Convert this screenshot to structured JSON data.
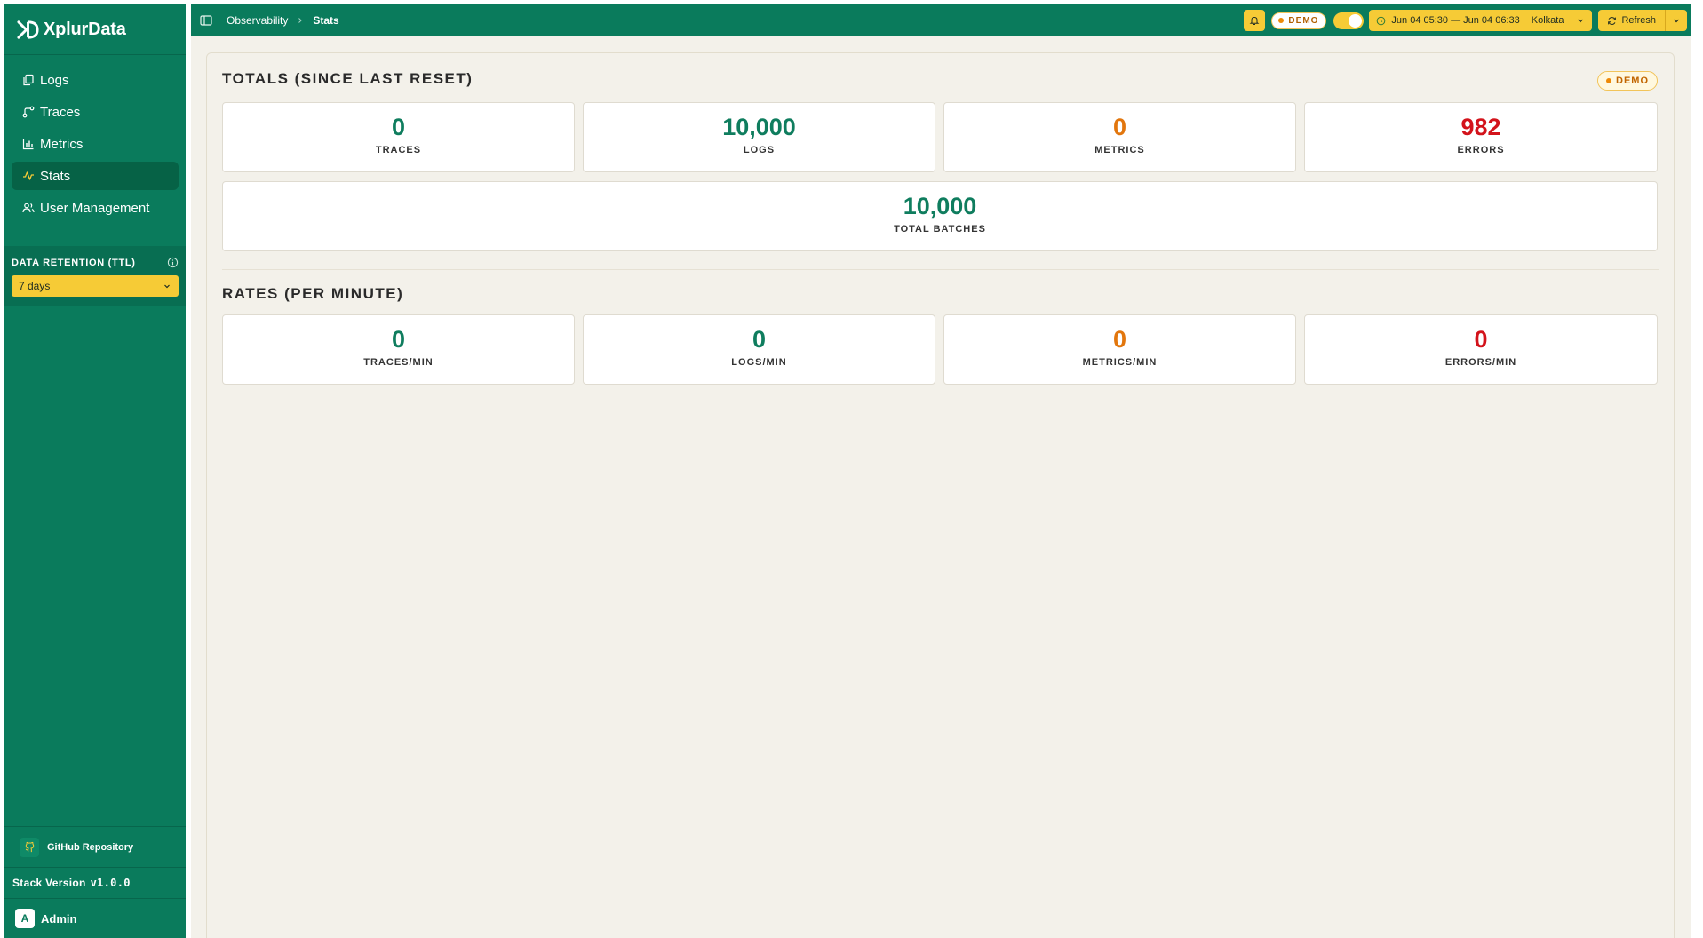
{
  "brand": {
    "name": "XplurData"
  },
  "sidebar": {
    "items": [
      {
        "label": "Logs",
        "icon": "logs-icon"
      },
      {
        "label": "Traces",
        "icon": "traces-icon"
      },
      {
        "label": "Metrics",
        "icon": "metrics-icon"
      },
      {
        "label": "Stats",
        "icon": "stats-icon",
        "active": true
      },
      {
        "label": "User Management",
        "icon": "users-icon"
      }
    ],
    "retention": {
      "label": "DATA RETENTION (TTL)",
      "value": "7 days"
    },
    "github_label": "GitHub Repository",
    "version_label": "Stack Version",
    "version_value": "v1.0.0",
    "user": {
      "initial": "A",
      "name": "Admin"
    }
  },
  "header": {
    "breadcrumb": {
      "parent": "Observability",
      "current": "Stats"
    },
    "demo_label": "DEMO",
    "time_range": "Jun 04 05:30 — Jun 04 06:33",
    "timezone": "Kolkata",
    "refresh_label": "Refresh"
  },
  "stats": {
    "demo_label": "DEMO",
    "totals_title": "TOTALS (SINCE LAST RESET)",
    "totals": [
      {
        "value": "0",
        "label": "TRACES",
        "color": "#0f7d5e"
      },
      {
        "value": "10,000",
        "label": "LOGS",
        "color": "#0f7d5e"
      },
      {
        "value": "0",
        "label": "METRICS",
        "color": "#e2760d"
      },
      {
        "value": "982",
        "label": "ERRORS",
        "color": "#d3131b"
      }
    ],
    "batches": {
      "value": "10,000",
      "label": "TOTAL BATCHES"
    },
    "rates_title": "RATES (PER MINUTE)",
    "rates": [
      {
        "value": "0",
        "label": "TRACES/MIN",
        "color": "#0f7d5e"
      },
      {
        "value": "0",
        "label": "LOGS/MIN",
        "color": "#0f7d5e"
      },
      {
        "value": "0",
        "label": "METRICS/MIN",
        "color": "#e2760d"
      },
      {
        "value": "0",
        "label": "ERRORS/MIN",
        "color": "#d3131b"
      }
    ]
  },
  "colors": {
    "brand_green": "#0a7b5c",
    "accent_yellow": "#f6cb36",
    "value_green": "#0f7d5e",
    "value_orange": "#e2760d",
    "value_red": "#d3131b"
  }
}
